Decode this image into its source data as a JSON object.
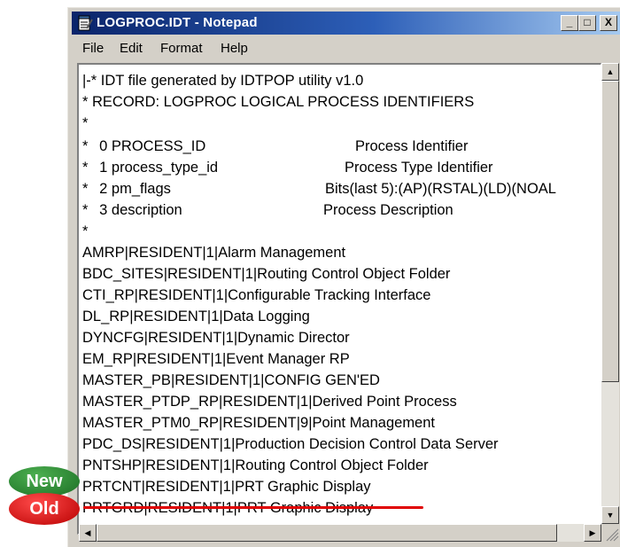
{
  "window": {
    "title": "LOGPROC.IDT - Notepad",
    "buttons": {
      "minimize": "_",
      "maximize": "□",
      "close": "X"
    }
  },
  "menu": [
    "File",
    "Edit",
    "Format",
    "Help"
  ],
  "header_lines": [
    "|-* IDT file generated by IDTPOP utility v1.0",
    "* RECORD: LOGPROC LOGICAL PROCESS IDENTIFIERS",
    "*"
  ],
  "fields": [
    {
      "star": "*",
      "name": "  0 PROCESS_ID",
      "desc": "Process Identifier"
    },
    {
      "star": "*",
      "name": "  1 process_type_id",
      "desc": "Process Type Identifier"
    },
    {
      "star": "*",
      "name": "  2 pm_flags",
      "desc": "Bits(last 5):(AP)(RSTAL)(LD)(NOAL"
    },
    {
      "star": "*",
      "name": "  3 description",
      "desc": "Process Description"
    }
  ],
  "separator": "*",
  "records": [
    "AMRP|RESIDENT|1|Alarm Management",
    "BDC_SITES|RESIDENT|1|Routing Control Object Folder",
    "CTI_RP|RESIDENT|1|Configurable Tracking Interface",
    "DL_RP|RESIDENT|1|Data Logging",
    "DYNCFG|RESIDENT|1|Dynamic Director",
    "EM_RP|RESIDENT|1|Event Manager RP",
    "MASTER_PB|RESIDENT|1|CONFIG GEN'ED",
    "MASTER_PTDP_RP|RESIDENT|1|Derived Point Process",
    "MASTER_PTM0_RP|RESIDENT|9|Point Management",
    "PDC_DS|RESIDENT|1|Production Decision Control Data Server",
    "PNTSHP|RESIDENT|1|Routing Control Object Folder",
    "PRTCNT|RESIDENT|1|PRT Graphic Display",
    "PRTGRD|RESIDENT|1|PRT Graphic Display"
  ],
  "annotations": {
    "new": "New",
    "old": "Old"
  },
  "colors": {
    "titlebar": "#0a246a",
    "new_badge": "#1b6e24",
    "old_badge": "#b80000",
    "strike": "#e00000"
  },
  "scrollbar_icons": {
    "up": "▲",
    "down": "▼",
    "left": "◀",
    "right": "▶"
  }
}
